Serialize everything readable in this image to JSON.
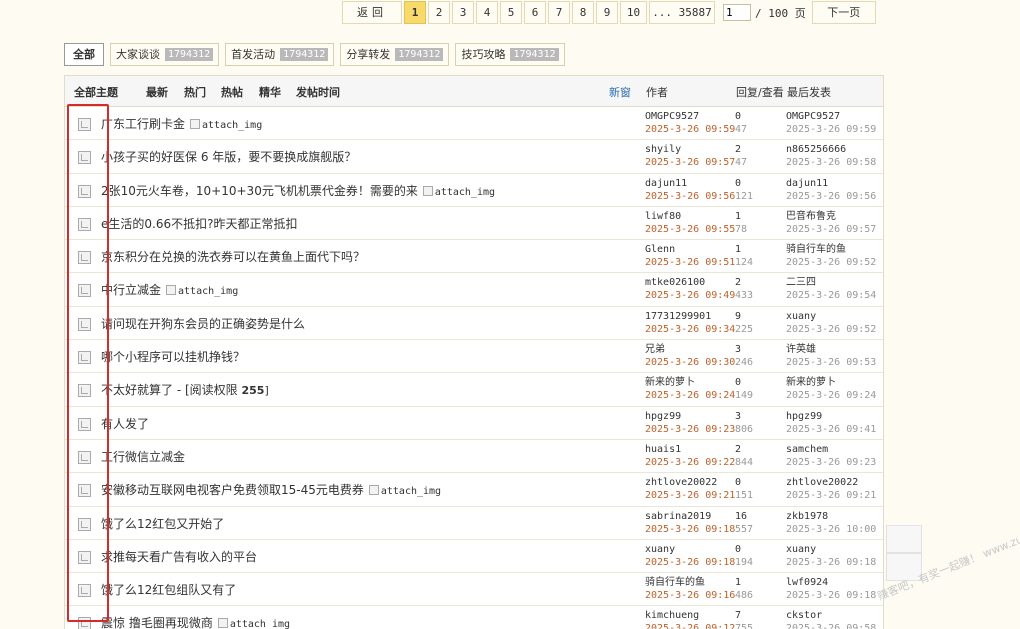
{
  "pager": {
    "prev": "返回",
    "pages": [
      "1",
      "2",
      "3",
      "4",
      "5",
      "6",
      "7",
      "8",
      "9",
      "10"
    ],
    "current": "1",
    "ellipsis": "... 35887",
    "input_value": "1",
    "total": "/ 100 页",
    "next": "下一页"
  },
  "tabs": [
    {
      "label": "全部",
      "badge": ""
    },
    {
      "label": "大家谈谈",
      "badge": "1794312"
    },
    {
      "label": "首发活动",
      "badge": "1794312"
    },
    {
      "label": "分享转发",
      "badge": "1794312"
    },
    {
      "label": "技巧攻略",
      "badge": "1794312"
    }
  ],
  "header": {
    "all": "全部主题",
    "latest": "最新",
    "hot": "热门",
    "hotpost": "热帖",
    "digest": "精华",
    "posttime": "发帖时间",
    "newwin": "新窗",
    "author": "作者",
    "reply_view": "回复/查看",
    "last_post": "最后发表"
  },
  "attach_label": "attach_img",
  "threads": [
    {
      "title": "广东工行刷卡金",
      "attach": true,
      "author": "OMGPC9527",
      "date": "2025-3-26 09:59",
      "replies": "0",
      "views": "47",
      "last_user": "OMGPC9527",
      "last_date": "2025-3-26 09:59"
    },
    {
      "title": "小孩子买的好医保 6 年版，要不要换成旗舰版？",
      "attach": false,
      "author": "shyily",
      "date": "2025-3-26 09:57",
      "replies": "2",
      "views": "47",
      "last_user": "n865256666",
      "last_date": "2025-3-26 09:58"
    },
    {
      "title": "2张10元火车卷，10+10+30元飞机机票代金券！需要的来",
      "attach": true,
      "author": "dajun11",
      "date": "2025-3-26 09:56",
      "replies": "0",
      "views": "121",
      "last_user": "dajun11",
      "last_date": "2025-3-26 09:56"
    },
    {
      "title": "e生活的0.66不抵扣?昨天都正常抵扣",
      "attach": false,
      "author": "liwf80",
      "date": "2025-3-26 09:55",
      "replies": "1",
      "views": "78",
      "last_user": "巴音布鲁克",
      "last_date": "2025-3-26 09:57"
    },
    {
      "title": "京东积分在兑换的洗衣券可以在黄鱼上面代下吗？",
      "attach": false,
      "author": "Glenn",
      "date": "2025-3-26 09:51",
      "replies": "1",
      "views": "124",
      "last_user": "骑自行车的鱼",
      "last_date": "2025-3-26 09:52"
    },
    {
      "title": "中行立减金",
      "attach": true,
      "author": "mtke026100",
      "date": "2025-3-26 09:49",
      "replies": "2",
      "views": "433",
      "last_user": "二三四",
      "last_date": "2025-3-26 09:54"
    },
    {
      "title": "请问现在开狗东会员的正确姿势是什么",
      "attach": false,
      "author": "17731299901",
      "date": "2025-3-26 09:34",
      "replies": "9",
      "views": "225",
      "last_user": "xuany",
      "last_date": "2025-3-26 09:52"
    },
    {
      "title": "哪个小程序可以挂机挣钱？",
      "attach": false,
      "author": "兄弟",
      "date": "2025-3-26 09:30",
      "replies": "3",
      "views": "246",
      "last_user": "许英雄",
      "last_date": "2025-3-26 09:53"
    },
    {
      "title": "不太好就算了 - [阅读权限 ",
      "perm": "255",
      "perm_close": "]",
      "attach": false,
      "author": "新来的萝卜",
      "date": "2025-3-26 09:24",
      "replies": "0",
      "views": "149",
      "last_user": "新来的萝卜",
      "last_date": "2025-3-26 09:24"
    },
    {
      "title": "有人发了",
      "attach": false,
      "author": "hpgz99",
      "date": "2025-3-26 09:23",
      "replies": "3",
      "views": "806",
      "last_user": "hpgz99",
      "last_date": "2025-3-26 09:41"
    },
    {
      "title": "工行微信立减金",
      "attach": false,
      "author": "huais1",
      "date": "2025-3-26 09:22",
      "replies": "2",
      "views": "844",
      "last_user": "samchem",
      "last_date": "2025-3-26 09:23"
    },
    {
      "title": "安徽移动互联网电视客户免费领取15-45元电费券",
      "attach": true,
      "author": "zhtlove20022",
      "date": "2025-3-26 09:21",
      "replies": "0",
      "views": "151",
      "last_user": "zhtlove20022",
      "last_date": "2025-3-26 09:21"
    },
    {
      "title": "饿了么12红包又开始了",
      "attach": false,
      "author": "sabrina2019",
      "date": "2025-3-26 09:18",
      "replies": "16",
      "views": "557",
      "last_user": "zkb1978",
      "last_date": "2025-3-26 10:00"
    },
    {
      "title": "求推每天看广告有收入的平台",
      "attach": false,
      "author": "xuany",
      "date": "2025-3-26 09:18",
      "replies": "0",
      "views": "194",
      "last_user": "xuany",
      "last_date": "2025-3-26 09:18"
    },
    {
      "title": "饿了么12红包组队又有了",
      "attach": false,
      "author": "骑自行车的鱼",
      "date": "2025-3-26 09:16",
      "replies": "1",
      "views": "486",
      "last_user": "lwf0924",
      "last_date": "2025-3-26 09:18"
    },
    {
      "title": "震惊 撸毛圈再现微商",
      "attach": true,
      "author": "kimchueng",
      "date": "2025-3-26 09:12",
      "replies": "7",
      "views": "755",
      "last_user": "ckstor",
      "last_date": "2025-3-26 09:58"
    }
  ],
  "watermark": "赚客吧，有奖一起赚！ www.zuanke8.com",
  "colors": {
    "accent_date": "#c0622a",
    "link_blue": "#2a6fb0",
    "highlight_red": "#d42b2b",
    "page_current": "#f7d96c"
  }
}
